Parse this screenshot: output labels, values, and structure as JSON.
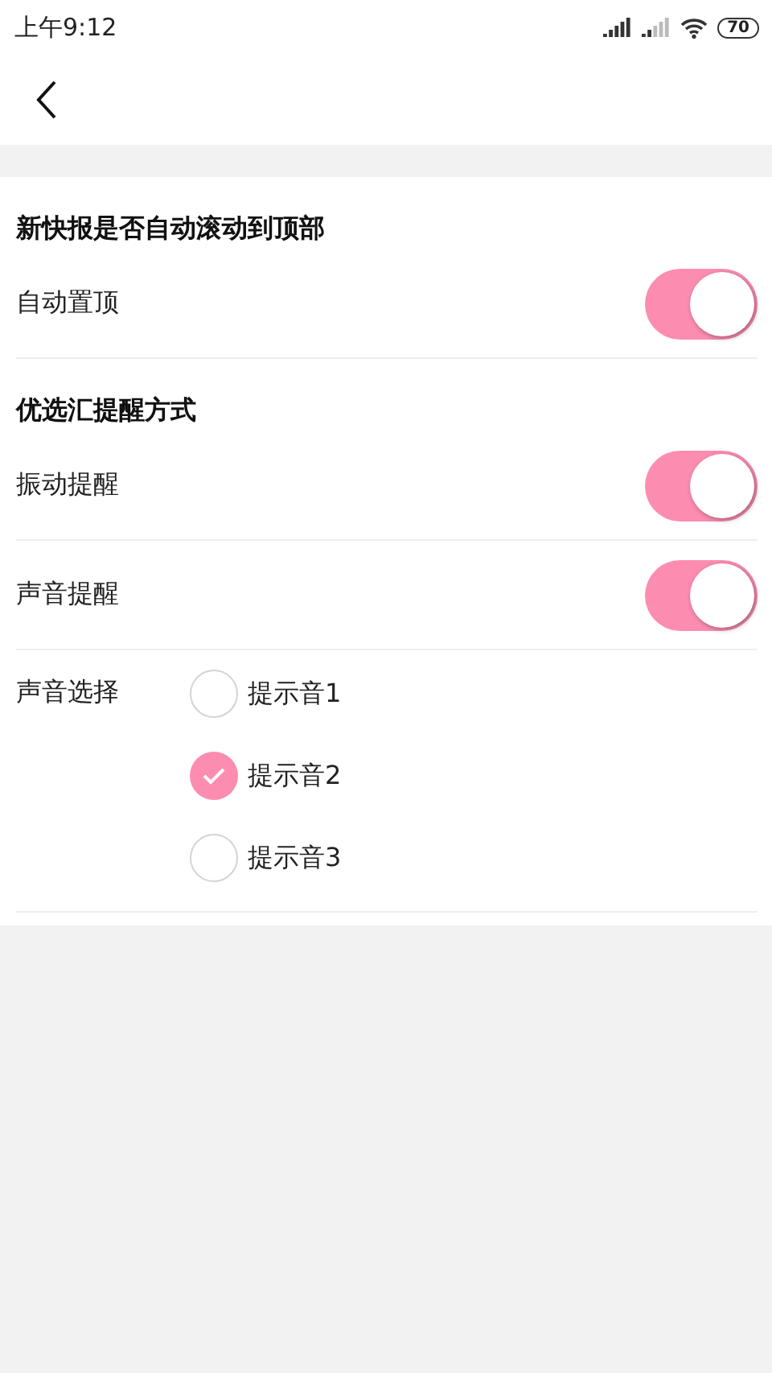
{
  "status_bar": {
    "time": "上午9:12",
    "battery": "70"
  },
  "sections": [
    {
      "title": "新快报是否自动滚动到顶部",
      "rows": [
        {
          "kind": "toggle",
          "label": "自动置顶",
          "on": true
        }
      ]
    },
    {
      "title": "优选汇提醒方式",
      "rows": [
        {
          "kind": "toggle",
          "label": "振动提醒",
          "on": true
        },
        {
          "kind": "toggle",
          "label": "声音提醒",
          "on": true
        },
        {
          "kind": "radio",
          "label": "声音选择",
          "options": [
            {
              "label": "提示音1",
              "selected": false
            },
            {
              "label": "提示音2",
              "selected": true
            },
            {
              "label": "提示音3",
              "selected": false
            }
          ]
        }
      ]
    }
  ]
}
